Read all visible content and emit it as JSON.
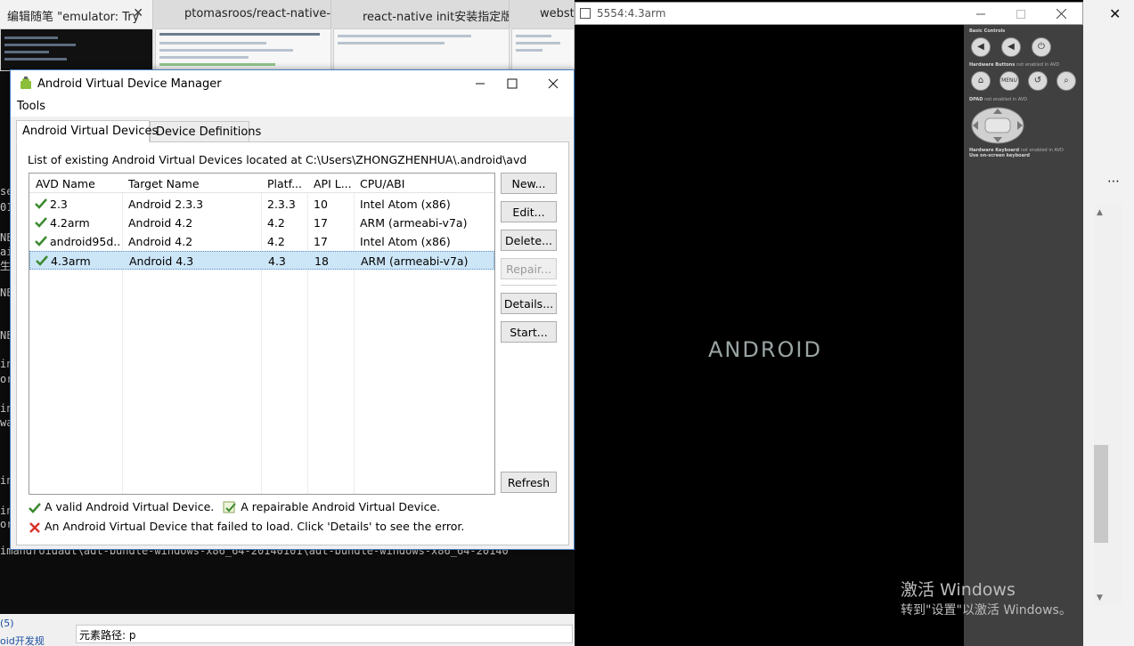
{
  "browser": {
    "tabs": [
      {
        "label": "编辑随笔 \"emulator: Try",
        "close": "✕"
      },
      {
        "label": "ptomasroos/react-native-ta"
      },
      {
        "label": "react-native init安装指定版"
      },
      {
        "label": "websto"
      }
    ]
  },
  "terminal": {
    "lines": [
      "se",
      "01",
      "NE",
      "ai",
      "生",
      "NE",
      "NE",
      "in",
      "or",
      "in",
      "wa",
      "in",
      "in",
      "or",
      "imandroidadt\\adt-bundle-windows-x86_64-20140101\\adt-bundle-windows-x86_64-20140"
    ]
  },
  "statusbar": {
    "link1": "(5)",
    "link2": "oid开发规",
    "path_value": "元素路径: p"
  },
  "avd": {
    "title": "Android Virtual Device Manager",
    "menu": "Tools",
    "tabs": [
      "Android Virtual Devices",
      "Device Definitions"
    ],
    "description": "List of existing Android Virtual Devices located at C:\\Users\\ZHONGZHENHUA\\.android\\avd",
    "columns": [
      "AVD Name",
      "Target Name",
      "Platf...",
      "API L...",
      "CPU/ABI"
    ],
    "rows": [
      {
        "name": "2.3",
        "target": "Android 2.3.3",
        "platform": "2.3.3",
        "api": "10",
        "cpu": "Intel Atom (x86)"
      },
      {
        "name": "4.2arm",
        "target": "Android 4.2",
        "platform": "4.2",
        "api": "17",
        "cpu": "ARM (armeabi-v7a)"
      },
      {
        "name": "android95d...",
        "target": "Android 4.2",
        "platform": "4.2",
        "api": "17",
        "cpu": "Intel Atom (x86)"
      },
      {
        "name": "4.3arm",
        "target": "Android 4.3",
        "platform": "4.3",
        "api": "18",
        "cpu": "ARM (armeabi-v7a)"
      }
    ],
    "selected_row": 3,
    "buttons": {
      "new": "New...",
      "edit": "Edit...",
      "delete": "Delete...",
      "repair": "Repair...",
      "details": "Details...",
      "start": "Start...",
      "refresh": "Refresh"
    },
    "legend": {
      "valid": "A valid Android Virtual Device.",
      "repairable": "A repairable Android Virtual Device.",
      "failed": "An Android Virtual Device that failed to load. Click 'Details' to see the error."
    }
  },
  "emulator": {
    "title": "5554:4.3arm",
    "boot_logo": "ANDROID",
    "sections": {
      "basic": "Basic Controls",
      "hardware": "Hardware Buttons",
      "hardware_note": "not enabled in AVD",
      "dpad": "DPAD",
      "dpad_note": "not enabled in AVD",
      "keyboard": "Hardware Keyboard",
      "keyboard_note": "not enabled in AVD",
      "keyboard_line2": "Use on-screen keyboard"
    },
    "hw_labels": {
      "menu": "MENU"
    }
  },
  "right": {
    "close": "✕",
    "more": "⋯"
  },
  "watermark": {
    "line1": "激活 Windows",
    "line2": "转到\"设置\"以激活 Windows。"
  },
  "colors": {
    "accent": "#4a7fc1",
    "selection": "#cde6f7",
    "check": "#3b8a2e",
    "error": "#d9332b"
  }
}
